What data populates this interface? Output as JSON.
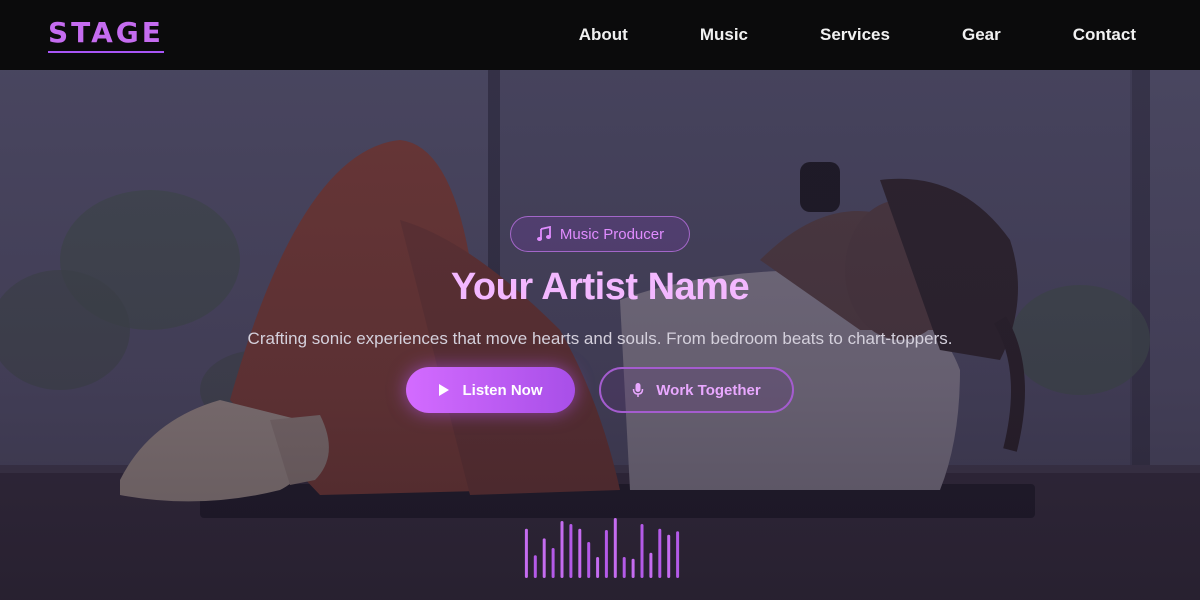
{
  "nav": {
    "logo": "STAGE",
    "links": [
      "About",
      "Music",
      "Services",
      "Gear",
      "Contact"
    ]
  },
  "hero": {
    "badge": {
      "icon": "music-note-icon",
      "label": "Music Producer"
    },
    "title": "Your Artist Name",
    "subtitle": "Crafting sonic experiences that move hearts and souls. From bedroom beats to chart-toppers.",
    "primary_button": {
      "icon": "play-icon",
      "label": "Listen Now"
    },
    "secondary_button": {
      "icon": "microphone-icon",
      "label": "Work Together"
    },
    "equalizer": {
      "icon": "sound-wave-bars",
      "levels": [
        0.82,
        0.38,
        0.66,
        0.5,
        0.95,
        0.9,
        0.82,
        0.6,
        0.35,
        0.8,
        1.0,
        0.35,
        0.32,
        0.9,
        0.42,
        0.82,
        0.72,
        0.78
      ]
    }
  },
  "colors": {
    "accent": "#c56cf0",
    "button_gradient_start": "#d36bff",
    "button_gradient_end": "#a84fe8",
    "title": "#f3b8ff",
    "nav_bg": "#0b0b0c"
  }
}
